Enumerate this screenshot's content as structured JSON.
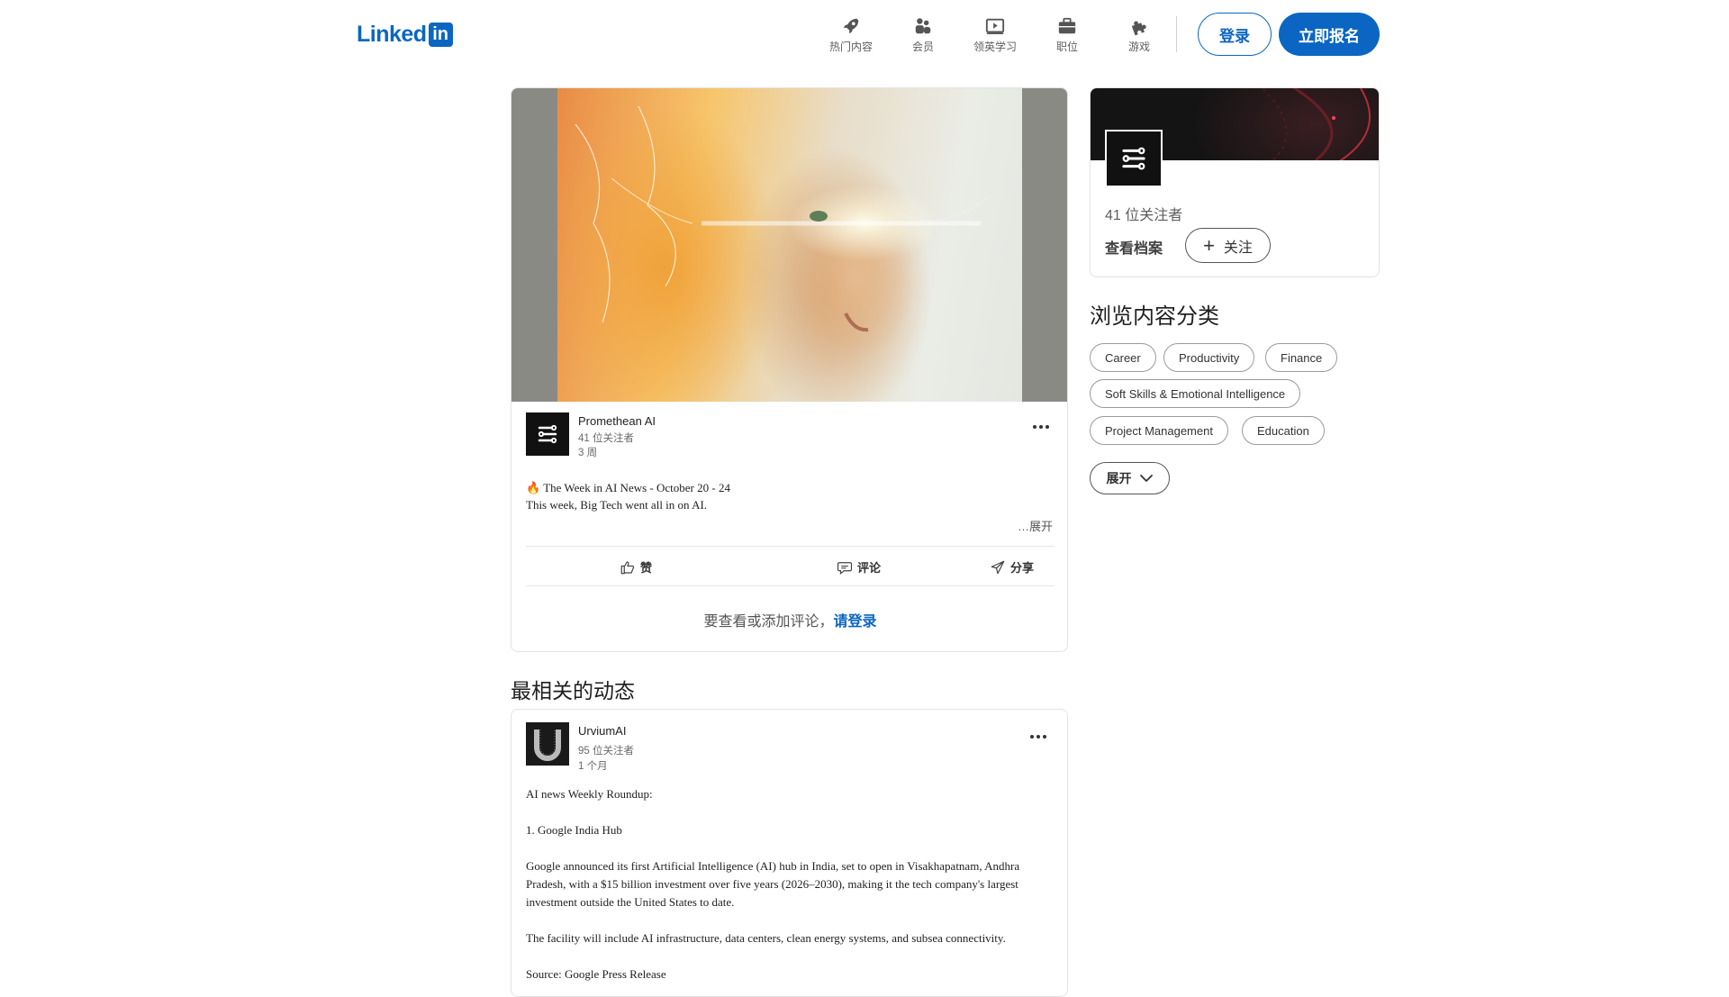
{
  "header": {
    "logo_text": "Linked",
    "logo_box": "in",
    "nav": [
      {
        "label": "热门内容",
        "icon": "rocket-icon"
      },
      {
        "label": "会员",
        "icon": "people-icon"
      },
      {
        "label": "领英学习",
        "icon": "play-video-icon"
      },
      {
        "label": "职位",
        "icon": "briefcase-icon"
      },
      {
        "label": "游戏",
        "icon": "puzzle-icon"
      }
    ],
    "login_label": "登录",
    "join_label": "立即报名"
  },
  "post": {
    "author": "Promethean AI",
    "followers": "41 位关注者",
    "time": "3 周",
    "title_line": "🔥 The Week in AI News - October 20 - 24",
    "body_line": "This week, Big Tech went all in on AI.",
    "see_more": "…展开",
    "actions": {
      "like": "赞",
      "comment": "评论",
      "share": "分享"
    },
    "comment_prompt": "要查看或添加评论，",
    "comment_link": "请登录"
  },
  "related_title": "最相关的动态",
  "post2": {
    "author": "UrviumAI",
    "followers": "95 位关注者",
    "time": "1 个月",
    "paragraphs": [
      "AI news Weekly Roundup:",
      "1. Google India Hub",
      "Google announced its first Artificial Intelligence (AI) hub in India, set to open in Visakhapatnam, Andhra Pradesh, with a $15 billion investment over five years (2026–2030), making it the tech company's largest investment outside the United States to date.",
      "The facility will include AI infrastructure, data centers, clean energy systems, and subsea connectivity.",
      "Source: Google Press Release"
    ]
  },
  "profile": {
    "followers": "41 位关注者",
    "view_profile": "查看档案",
    "follow": "关注"
  },
  "browse": {
    "title": "浏览内容分类",
    "chips": [
      "Career",
      "Productivity",
      "Finance",
      "Soft Skills & Emotional Intelligence",
      "Project Management",
      "Education"
    ],
    "expand": "展开"
  },
  "colors": {
    "brand": "#0a66c2"
  }
}
